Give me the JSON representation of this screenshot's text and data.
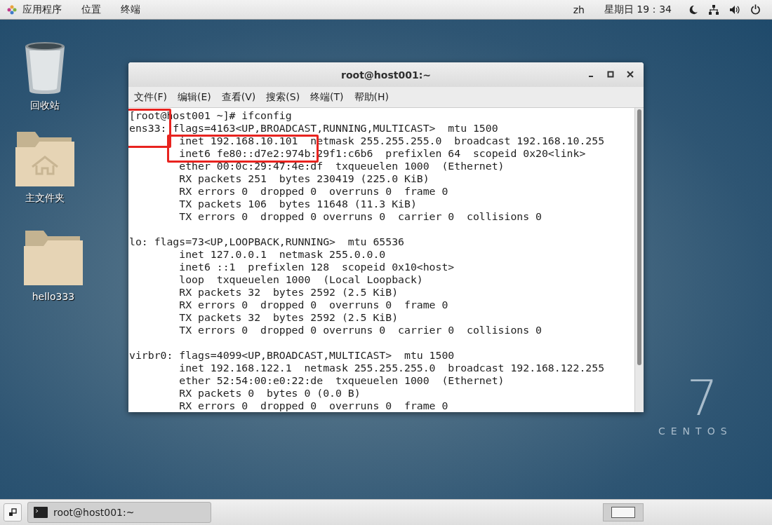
{
  "top_bar": {
    "menus": [
      "应用程序",
      "位置",
      "终端"
    ],
    "language": "zh",
    "clock": "星期日 19：34"
  },
  "desktop_icons": [
    {
      "label": "回收站",
      "kind": "trash"
    },
    {
      "label": "主文件夹",
      "kind": "home"
    },
    {
      "label": "hello333",
      "kind": "folder"
    }
  ],
  "wallpaper": {
    "version": "7",
    "brand": "CENTOS"
  },
  "terminal": {
    "title": "root@host001:~",
    "menu": [
      "文件(F)",
      "编辑(E)",
      "查看(V)",
      "搜索(S)",
      "终端(T)",
      "帮助(H)"
    ],
    "blocks": [
      [
        "[root@host001 ~]# ifconfig",
        "ens33: flags=4163<UP,BROADCAST,RUNNING,MULTICAST>  mtu 1500",
        "        inet 192.168.10.101  netmask 255.255.255.0  broadcast 192.168.10.255",
        "        inet6 fe80::d7e2:974b:29f1:c6b6  prefixlen 64  scopeid 0x20<link>",
        "        ether 00:0c:29:47:4e:df  txqueuelen 1000  (Ethernet)",
        "        RX packets 251  bytes 230419 (225.0 KiB)",
        "        RX errors 0  dropped 0  overruns 0  frame 0",
        "        TX packets 106  bytes 11648 (11.3 KiB)",
        "        TX errors 0  dropped 0 overruns 0  carrier 0  collisions 0"
      ],
      [
        "lo: flags=73<UP,LOOPBACK,RUNNING>  mtu 65536",
        "        inet 127.0.0.1  netmask 255.0.0.0",
        "        inet6 ::1  prefixlen 128  scopeid 0x10<host>",
        "        loop  txqueuelen 1000  (Local Loopback)",
        "        RX packets 32  bytes 2592 (2.5 KiB)",
        "        RX errors 0  dropped 0  overruns 0  frame 0",
        "        TX packets 32  bytes 2592 (2.5 KiB)",
        "        TX errors 0  dropped 0 overruns 0  carrier 0  collisions 0"
      ],
      [
        "virbr0: flags=4099<UP,BROADCAST,MULTICAST>  mtu 1500",
        "        inet 192.168.122.1  netmask 255.255.255.0  broadcast 192.168.122.255",
        "        ether 52:54:00:e0:22:de  txqueuelen 1000  (Ethernet)",
        "        RX packets 0  bytes 0 (0.0 B)",
        "        RX errors 0  dropped 0  overruns 0  frame 0"
      ]
    ]
  },
  "taskbar": {
    "window_button": "root@host001:~"
  }
}
